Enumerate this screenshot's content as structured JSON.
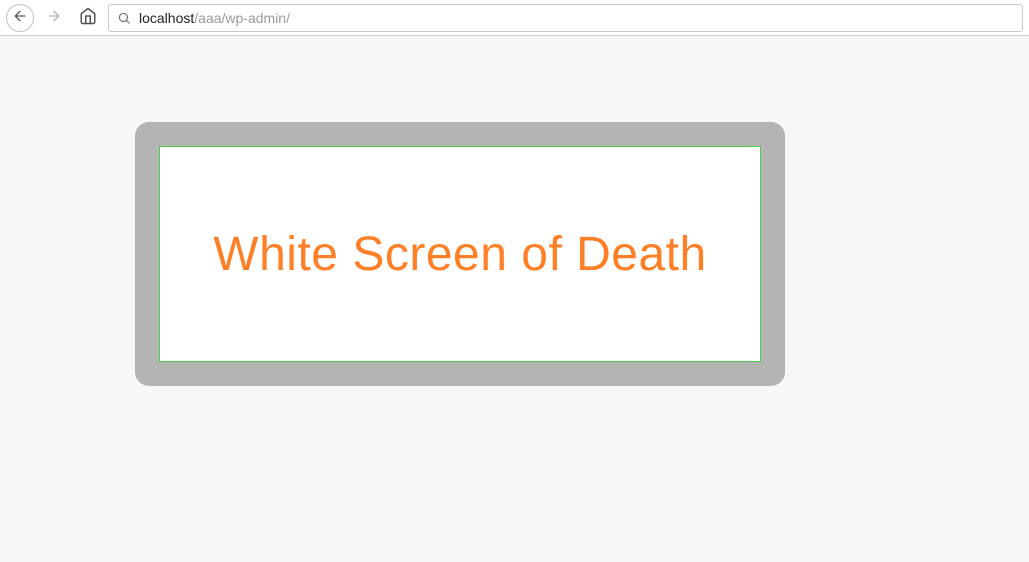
{
  "browser": {
    "url_host": "localhost",
    "url_path": "/aaa/wp-admin/"
  },
  "callout": {
    "text": "White Screen of Death"
  },
  "colors": {
    "callout_text": "#ff7f27",
    "callout_border": "#46d246",
    "frame_bg": "#b4b4b4"
  }
}
